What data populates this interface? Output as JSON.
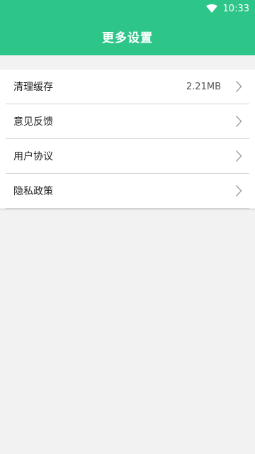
{
  "status_bar": {
    "time": "10:33",
    "icons": [
      "wifi-icon"
    ]
  },
  "app_bar": {
    "title": "更多设置"
  },
  "menu": {
    "items": [
      {
        "label": "清理缓存",
        "value": "2.21MB",
        "icon": "chevron-right-icon"
      },
      {
        "label": "意见反馈",
        "icon": "chevron-right-icon"
      },
      {
        "label": "用户协议",
        "icon": "chevron-right-icon"
      },
      {
        "label": "隐私政策",
        "icon": "chevron-right-icon"
      }
    ]
  },
  "colors": {
    "accent": "#2ec589",
    "background": "#f2f2f2",
    "card": "#ffffff",
    "chevron": "#9e9e9e"
  }
}
